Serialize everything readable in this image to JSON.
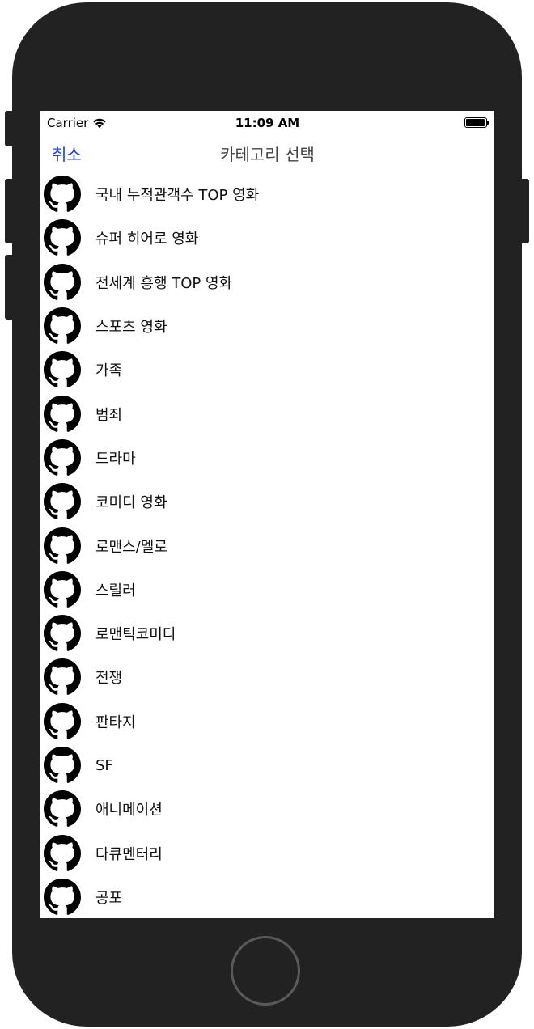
{
  "status_bar": {
    "carrier": "Carrier",
    "time": "11:09 AM",
    "wifi_icon": "wifi-icon",
    "battery_icon": "battery-full-icon"
  },
  "nav": {
    "cancel_label": "취소",
    "title": "카테고리 선택",
    "accent_color": "#1a3fd6"
  },
  "categories": [
    {
      "label": "국내 누적관객수 TOP 영화",
      "icon": "github-octocat-icon"
    },
    {
      "label": "슈퍼 히어로 영화",
      "icon": "github-octocat-icon"
    },
    {
      "label": "전세계 흥행 TOP 영화",
      "icon": "github-octocat-icon"
    },
    {
      "label": "스포츠 영화",
      "icon": "github-octocat-icon"
    },
    {
      "label": "가족",
      "icon": "github-octocat-icon"
    },
    {
      "label": "범죄",
      "icon": "github-octocat-icon"
    },
    {
      "label": "드라마",
      "icon": "github-octocat-icon"
    },
    {
      "label": "코미디 영화",
      "icon": "github-octocat-icon"
    },
    {
      "label": "로맨스/멜로",
      "icon": "github-octocat-icon"
    },
    {
      "label": "스릴러",
      "icon": "github-octocat-icon"
    },
    {
      "label": "로맨틱코미디",
      "icon": "github-octocat-icon"
    },
    {
      "label": "전쟁",
      "icon": "github-octocat-icon"
    },
    {
      "label": "판타지",
      "icon": "github-octocat-icon"
    },
    {
      "label": "SF",
      "icon": "github-octocat-icon"
    },
    {
      "label": "애니메이션",
      "icon": "github-octocat-icon"
    },
    {
      "label": "다큐멘터리",
      "icon": "github-octocat-icon"
    },
    {
      "label": "공포",
      "icon": "github-octocat-icon"
    }
  ]
}
